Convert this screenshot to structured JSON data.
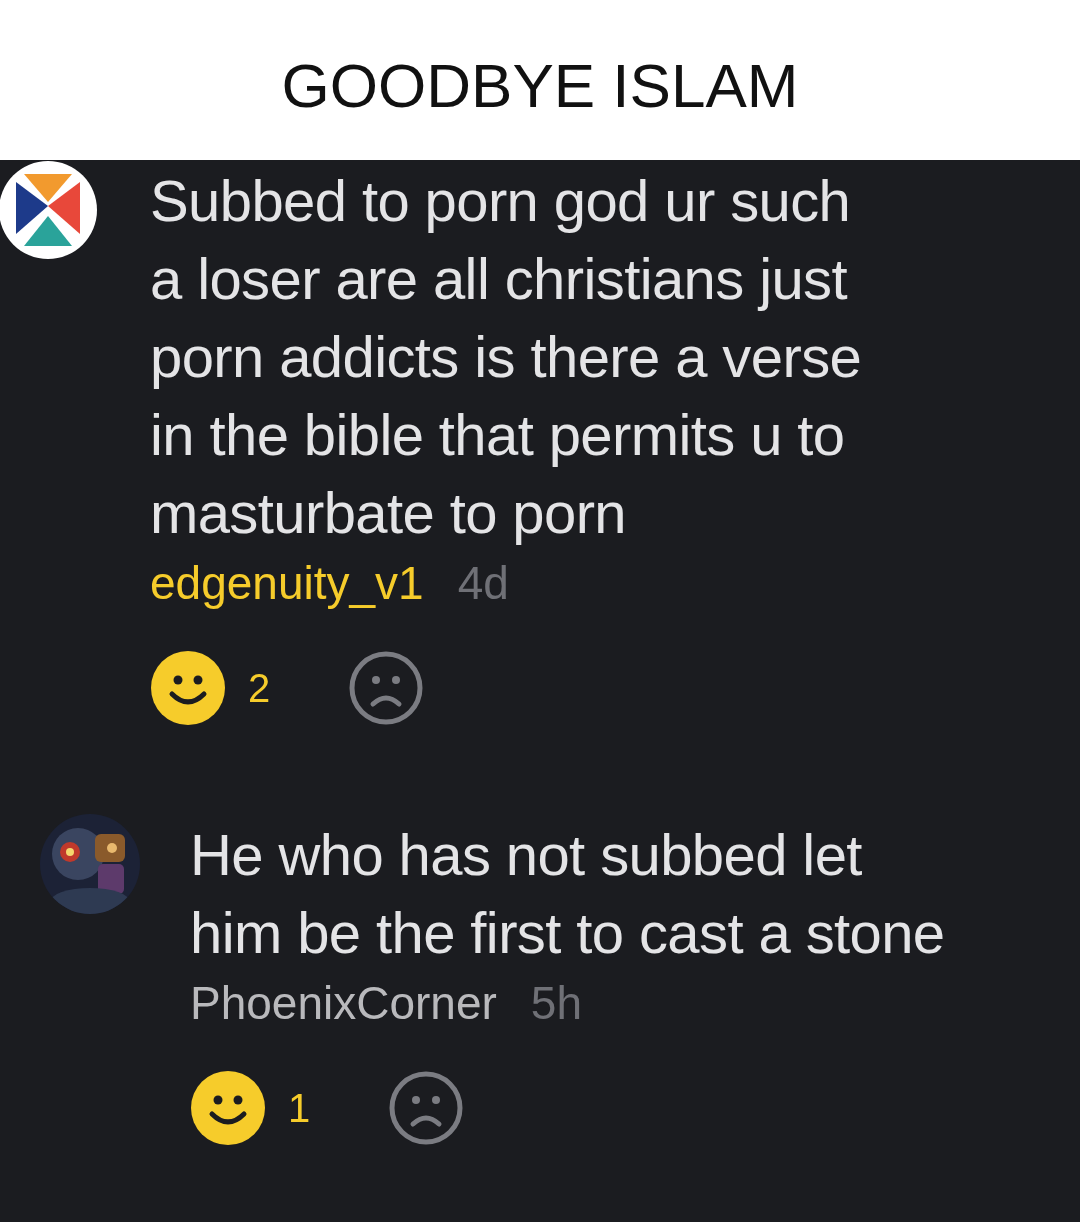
{
  "title": "GOODBYE ISLAM",
  "comments": [
    {
      "kind": "comment",
      "avatar": {
        "kind": "logo"
      },
      "text_lines": [
        "Subbed to porn god ur such",
        "a loser are all christians just",
        "porn addicts is there a verse",
        "in the bible that permits u to",
        "masturbate to porn"
      ],
      "username": "edgenuity_v1",
      "username_highlighted": true,
      "time": "4d",
      "likes": "2"
    },
    {
      "kind": "reply",
      "text_lines": [
        "He who has not subbed let",
        "him be the first to cast a stone"
      ],
      "username": "PhoenixCorner",
      "username_highlighted": false,
      "time": "5h",
      "likes": "1"
    }
  ]
}
